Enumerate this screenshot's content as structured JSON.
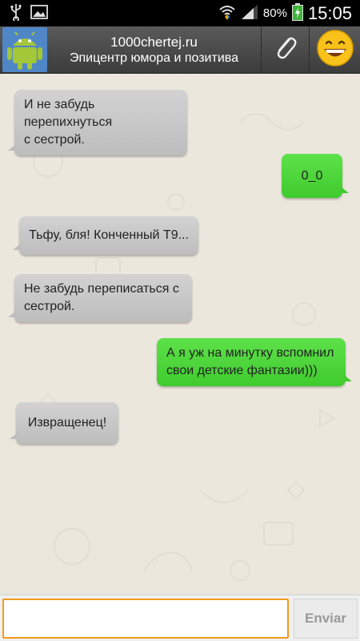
{
  "status_bar": {
    "battery_percent": "80%",
    "time": "15:05",
    "icons": [
      "usb-icon",
      "image-icon",
      "wifi-icon",
      "signal-icon",
      "battery-icon"
    ]
  },
  "header": {
    "title": "1000chertej.ru",
    "subtitle": "Эпицентр юмора и позитива",
    "avatar_icon": "android-icon",
    "attach_icon": "paperclip-icon",
    "emoji_icon": "smiley-icon"
  },
  "messages": [
    {
      "direction": "in",
      "text_lines": [
        "И не забудь перепихнуться",
        "с сестрой."
      ]
    },
    {
      "direction": "out",
      "text_lines": [
        "0_0"
      ]
    },
    {
      "direction": "in",
      "text_lines": [
        "Тьфу, бля! Конченный Т9..."
      ]
    },
    {
      "direction": "in",
      "text_lines": [
        "Не забудь переписаться с",
        "сестрой."
      ]
    },
    {
      "direction": "out",
      "text_lines": [
        "А я уж на минутку вспомнил",
        "свои детские фантазии)))"
      ]
    },
    {
      "direction": "in",
      "text_lines": [
        "Извращенец!"
      ]
    }
  ],
  "composer": {
    "input_value": "",
    "send_label": "Enviar"
  },
  "colors": {
    "incoming_bubble": "#c8c8c8",
    "outgoing_bubble": "#4fd63c",
    "input_border": "#f39a1e",
    "header": "#4a4a4a"
  }
}
